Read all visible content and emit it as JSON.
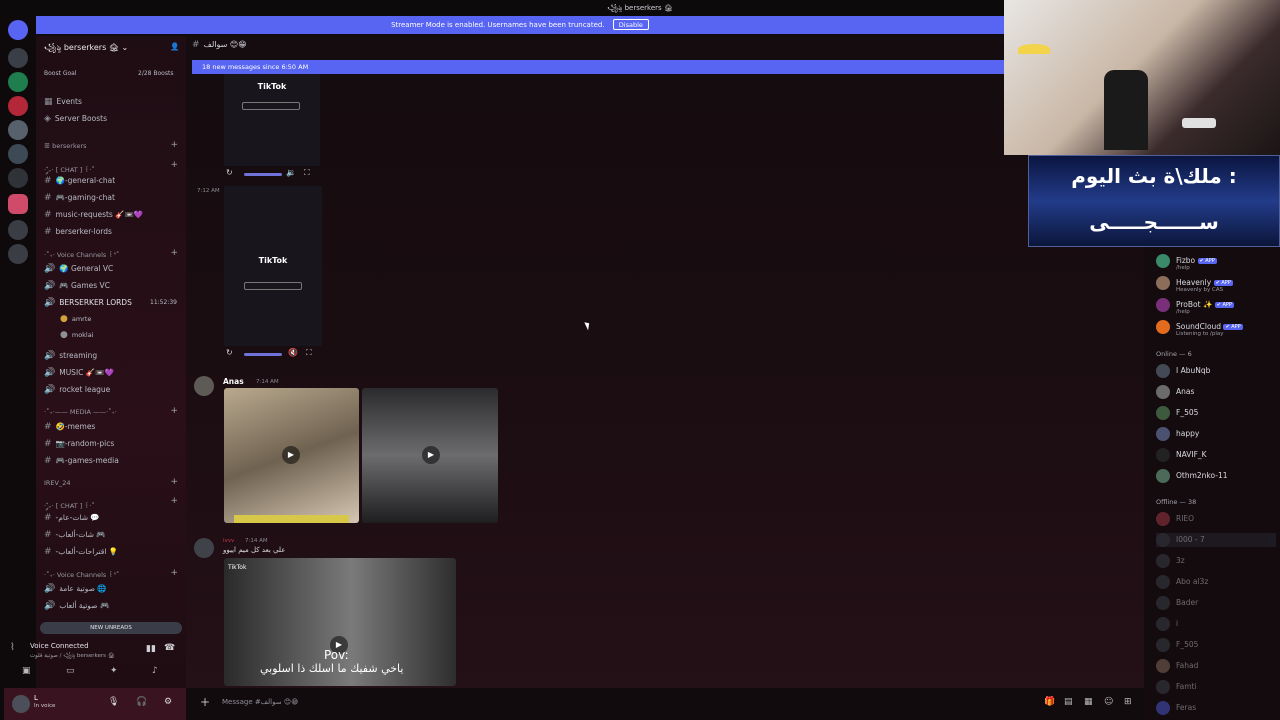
{
  "topbar": {
    "title": "꧁ৡ berserkers 🏚"
  },
  "banner": {
    "text": "Streamer Mode is enabled. Usernames have been truncated.",
    "disable": "Disable"
  },
  "server": {
    "name": "꧁ৡ berserkers 🏚",
    "boost_goal": "Boost Goal",
    "boosts": "2/28 Boosts"
  },
  "sidebar": {
    "events": "Events",
    "server_boosts": "Server Boosts",
    "cat_berserkers": "ꕥ berserkers",
    "cat_chat": "·˚༘₊· [ CHAT ] ꒰·˚",
    "ch_general": "🌍-general-chat",
    "ch_gaming": "🎮-gaming-chat",
    "ch_music": "music-requests 🎸📼💜",
    "ch_lords": "berserker-lords",
    "cat_voice": "·˚₊‧ Voice Channels ꒰ᐢ˚",
    "vc_general": "🌍 General VC",
    "vc_games": "🎮 Games VC",
    "vc_lords": "BERSERKER LORDS",
    "vc_lords_time": "11:52:39",
    "user_1": "amrte",
    "user_2": "moklai",
    "ch_streaming": "streaming",
    "ch_music2": "MUSIC 🎸📼💜",
    "ch_rocket": "rocket league",
    "cat_media": "·˚₊·—— MEDIA ——·˚₊·",
    "ch_memes": "🤣-memes",
    "ch_random": "📷-random-pics",
    "ch_games_media": "🎮-games-media",
    "cat_irev": "IREV_24",
    "cat_chat2": "·˚༘₊· [ CHAT ] ꒰·˚",
    "ch_ar1": "-شات-عام 💬",
    "ch_ar2": "-شات-ألعاب 🎮",
    "ch_ar3": "-اقتراحات-ألعاب 💡",
    "cat_voice2": "·˚₊‧ Voice Channels ꒰ᐢ˚",
    "vc_ar1": "صوتية عامة 🌐",
    "vc_ar2": "صوتية ألعاب 🎮",
    "new_unreads": "NEW UNREADS"
  },
  "voice": {
    "status": "Voice Connected",
    "location": "صوتية قلوت / ꧁ৡ berserkers 🏚"
  },
  "userpanel": {
    "name": "L",
    "status": "In voice"
  },
  "chat": {
    "channel": "سوالف 😊😁",
    "new_messages": "18 new messages since 6:50 AM",
    "tiktok": "TikTok",
    "time_1": "7:12 AM",
    "author_1": "Anas",
    "time_2": "7:14 AM",
    "author_2": "ivvv",
    "time_3": "7:14 AM",
    "msg_3": "علي بعد كل ميم اييوو",
    "pov": "Pov:",
    "subtitle": "ياخي شفيك ما اسلك ذا اسلوبي",
    "composer": "Message #سوالف 😊😁"
  },
  "members": {
    "bots": [
      {
        "name": "Fizbo",
        "sub": "/help"
      },
      {
        "name": "Heavenly",
        "sub": "Heavenly by CAS"
      },
      {
        "name": "ProBot ✨",
        "sub": "/help"
      },
      {
        "name": "SoundCloud",
        "sub": "Listening to /play"
      }
    ],
    "app_badge": "✔ APP",
    "online_header": "Online — 6",
    "online": [
      "I AbuNqb",
      "Anas",
      "F_505",
      "happy",
      "NAVIF_K",
      "Othm2nko-11"
    ],
    "offline_header": "Offline — 38",
    "offline": [
      "RIEO",
      "I000 - 7",
      "3z",
      "Abo al3z",
      "Bader",
      "i",
      "F_505",
      "Fahad",
      "Famti",
      "Feras"
    ]
  },
  "overlay": {
    "line1": "ملك\\ة بث اليوم :",
    "line2": "ســــــجـــــى"
  },
  "colors": {
    "accent": "#5865f2",
    "sidebar": "#2a0f18",
    "chat": "#1b0d12"
  }
}
